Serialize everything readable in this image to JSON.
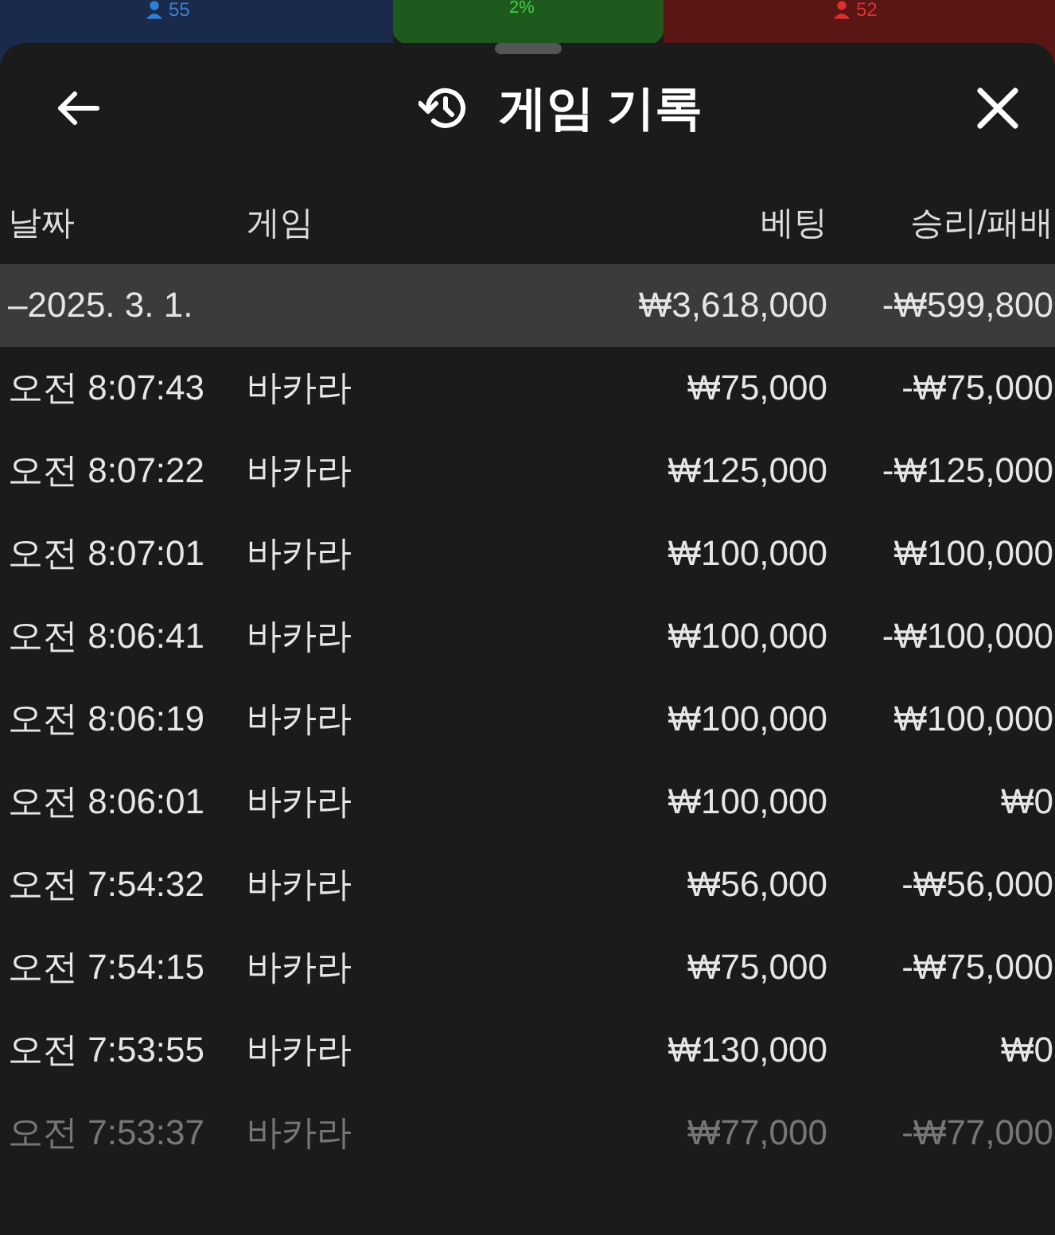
{
  "background_game": {
    "left_count": "55",
    "center_percent": "2%",
    "right_count": "52"
  },
  "sheet": {
    "title": "게임 기록"
  },
  "table": {
    "columns": [
      "날짜",
      "게임",
      "베팅",
      "승리/패배"
    ],
    "group": {
      "expanded": true,
      "toggle": "–",
      "date": "2025. 3. 1.",
      "bet": "₩3,618,000",
      "result": "-₩599,800"
    },
    "rows": [
      {
        "time": "오전 8:07:43",
        "game": "바카라",
        "bet": "₩75,000",
        "result": "-₩75,000",
        "faded": false
      },
      {
        "time": "오전 8:07:22",
        "game": "바카라",
        "bet": "₩125,000",
        "result": "-₩125,000",
        "faded": false
      },
      {
        "time": "오전 8:07:01",
        "game": "바카라",
        "bet": "₩100,000",
        "result": "₩100,000",
        "faded": false
      },
      {
        "time": "오전 8:06:41",
        "game": "바카라",
        "bet": "₩100,000",
        "result": "-₩100,000",
        "faded": false
      },
      {
        "time": "오전 8:06:19",
        "game": "바카라",
        "bet": "₩100,000",
        "result": "₩100,000",
        "faded": false
      },
      {
        "time": "오전 8:06:01",
        "game": "바카라",
        "bet": "₩100,000",
        "result": "₩0",
        "faded": false
      },
      {
        "time": "오전 7:54:32",
        "game": "바카라",
        "bet": "₩56,000",
        "result": "-₩56,000",
        "faded": false
      },
      {
        "time": "오전 7:54:15",
        "game": "바카라",
        "bet": "₩75,000",
        "result": "-₩75,000",
        "faded": false
      },
      {
        "time": "오전 7:53:55",
        "game": "바카라",
        "bet": "₩130,000",
        "result": "₩0",
        "faded": false
      },
      {
        "time": "오전 7:53:37",
        "game": "바카라",
        "bet": "₩77,000",
        "result": "-₩77,000",
        "faded": true
      }
    ]
  }
}
